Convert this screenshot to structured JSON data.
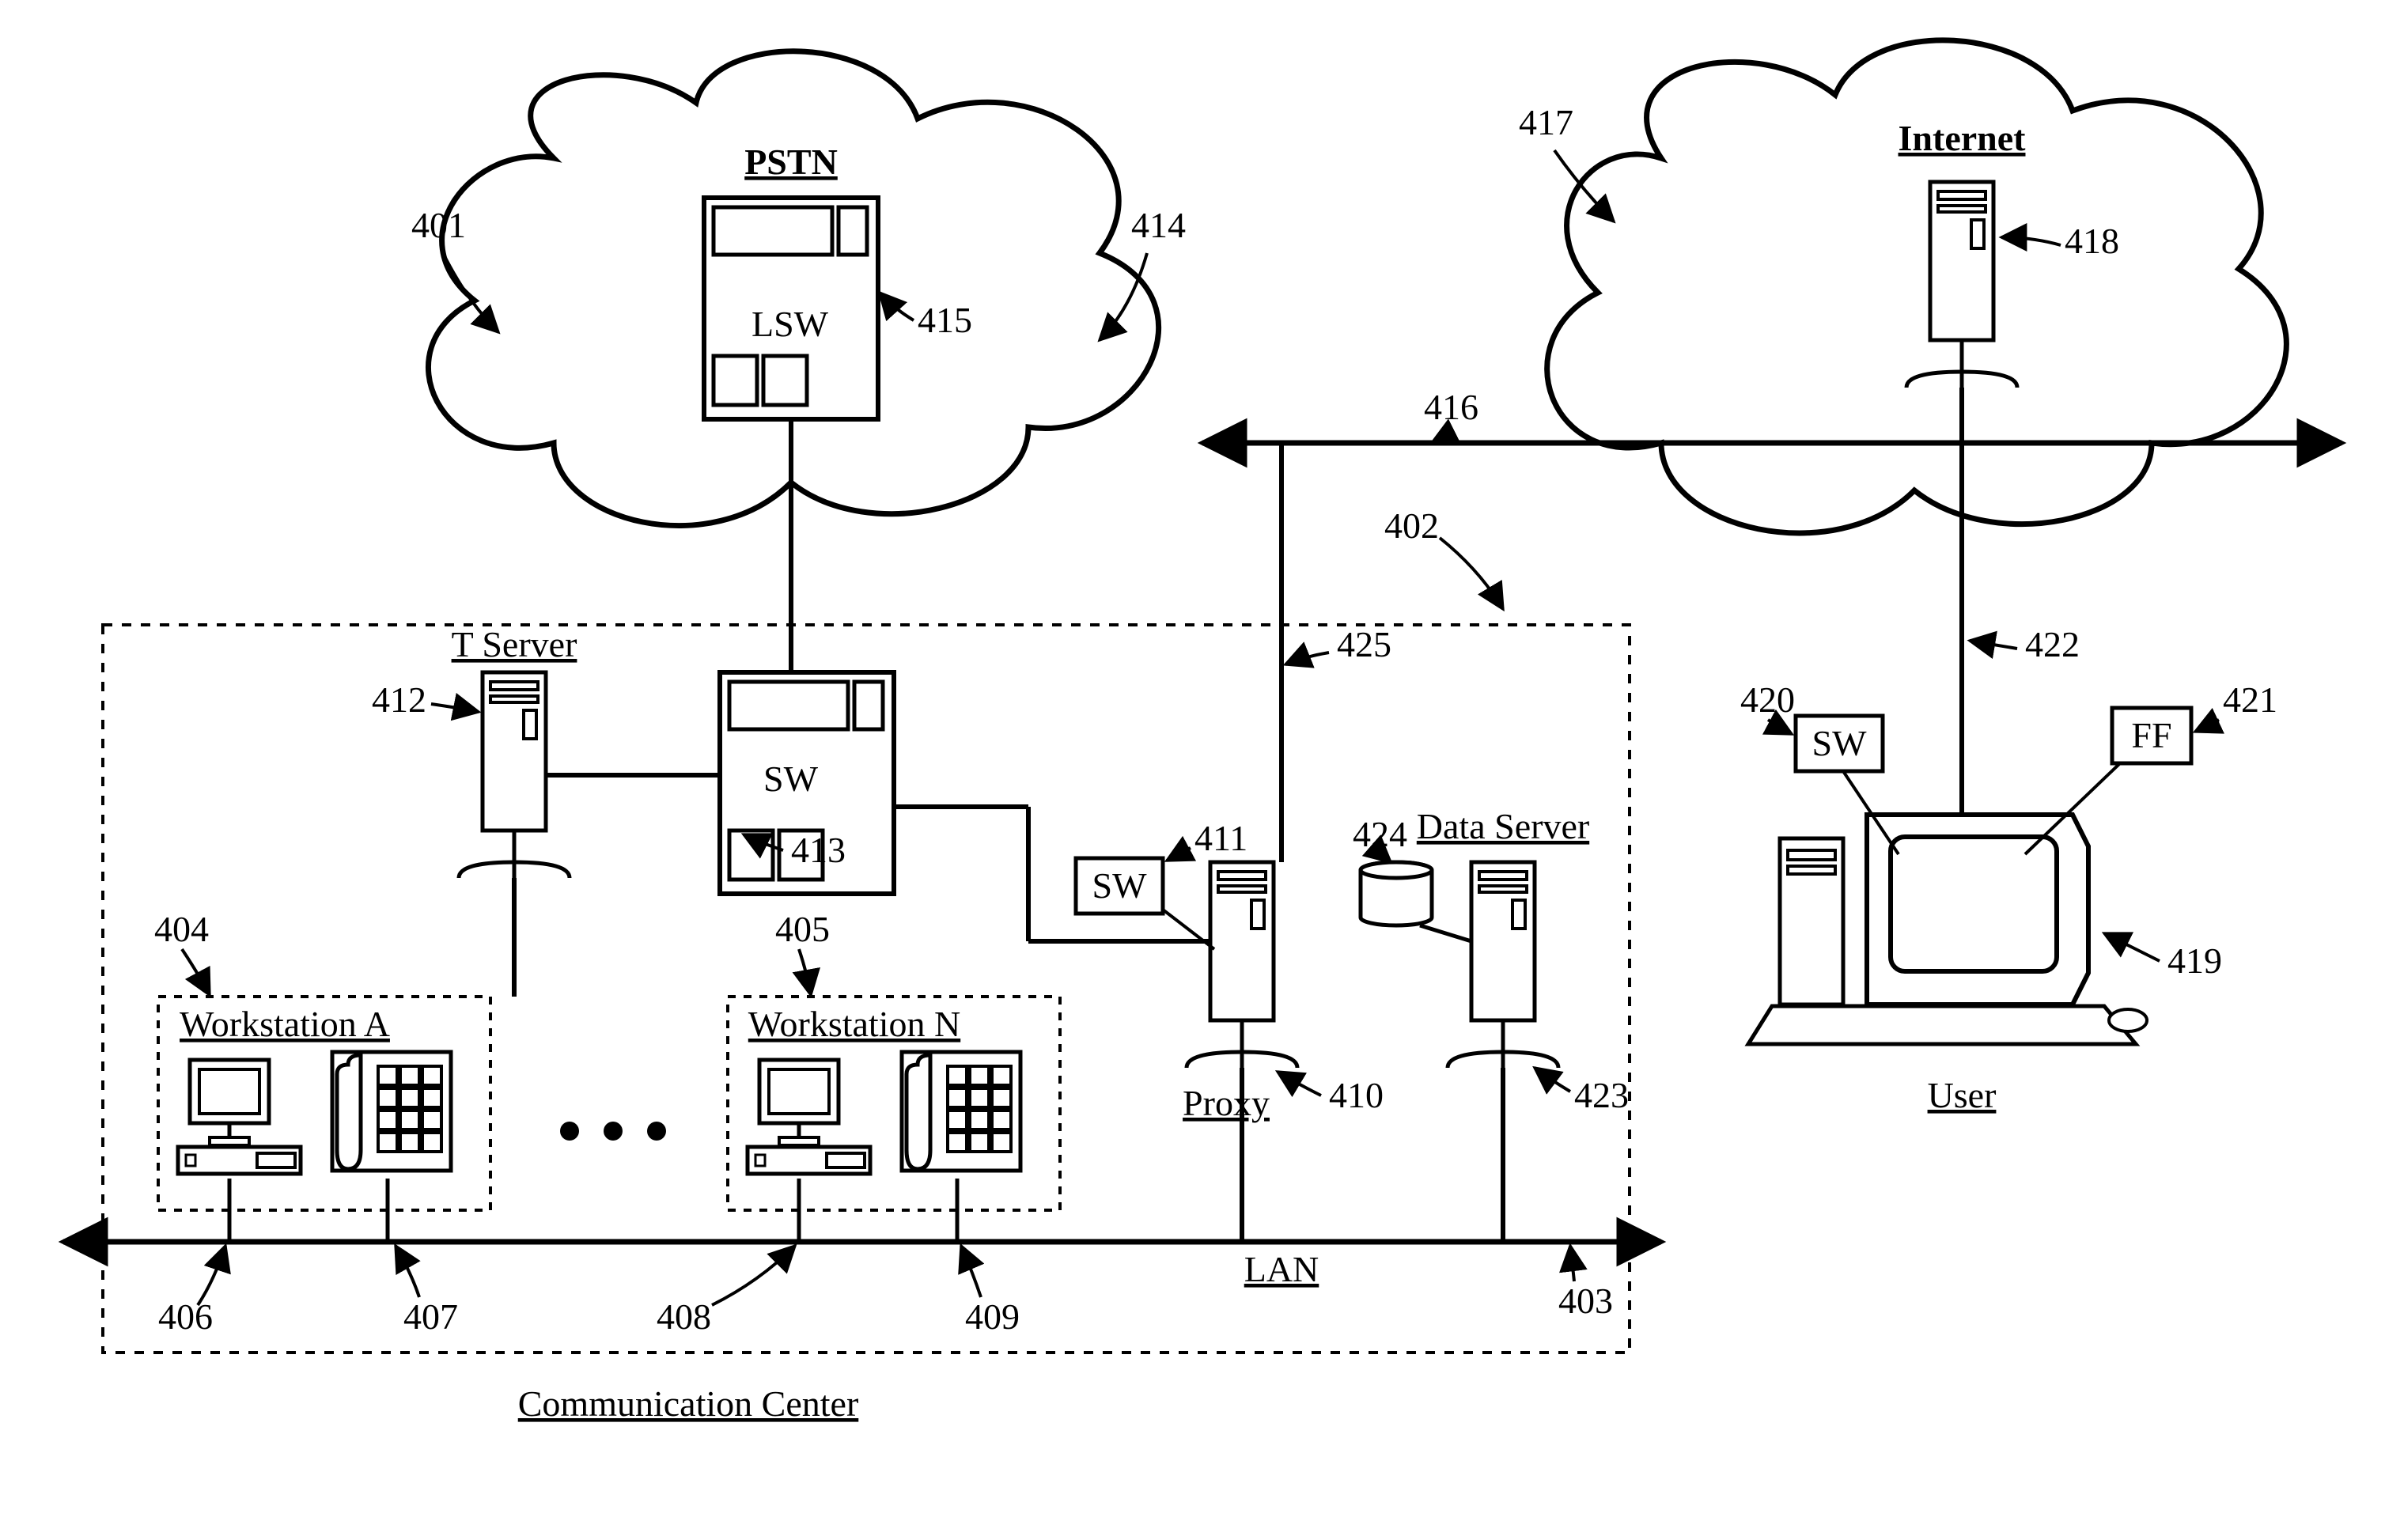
{
  "clouds": {
    "pstn": {
      "title": "PSTN",
      "switch_label": "LSW"
    },
    "internet": {
      "title": "Internet"
    }
  },
  "comm_center": {
    "title": "Communication Center",
    "t_server": "T Server",
    "workstation_a": "Workstation A",
    "workstation_n": "Workstation N",
    "proxy": "Proxy",
    "data_server": "Data Server",
    "lan": "LAN",
    "sw_box1": "SW",
    "sw_box2": "SW"
  },
  "user": {
    "title": "User",
    "sw": "SW",
    "ff": "FF"
  },
  "refs": {
    "r401": "401",
    "r402": "402",
    "r403": "403",
    "r404": "404",
    "r405": "405",
    "r406": "406",
    "r407": "407",
    "r408": "408",
    "r409": "409",
    "r410": "410",
    "r411": "411",
    "r412": "412",
    "r413": "413",
    "r414": "414",
    "r415": "415",
    "r416": "416",
    "r417": "417",
    "r418": "418",
    "r419": "419",
    "r420": "420",
    "r421": "421",
    "r422": "422",
    "r423": "423",
    "r424": "424",
    "r425": "425"
  }
}
